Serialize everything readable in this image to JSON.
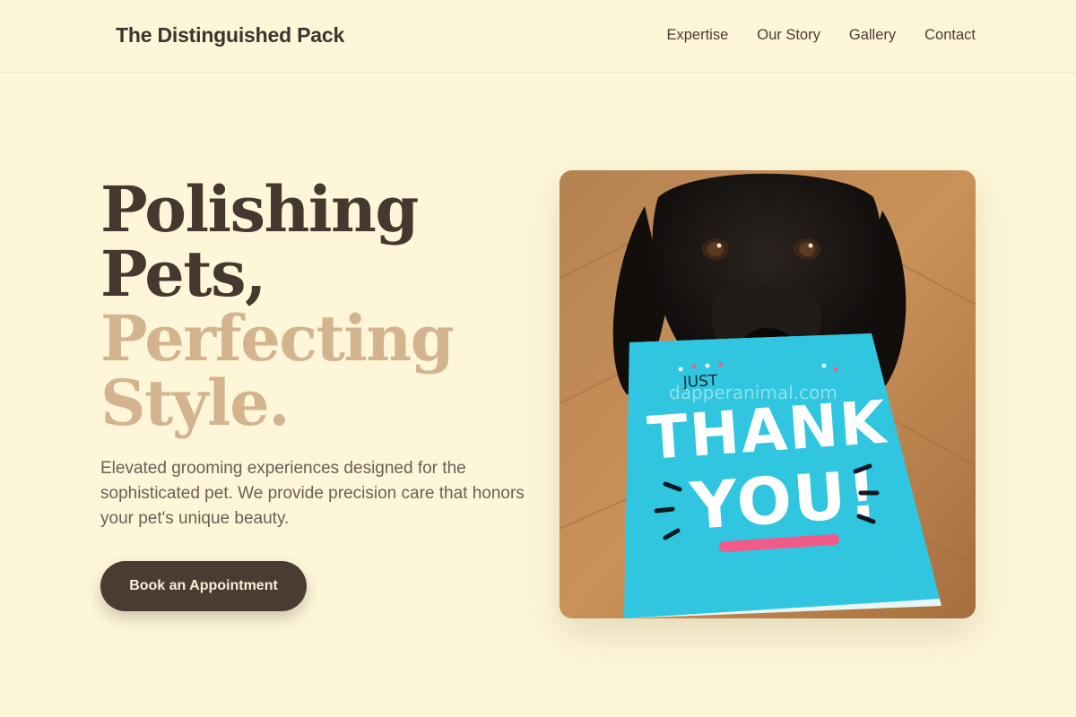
{
  "header": {
    "brand": "The Distinguished Pack",
    "nav": [
      "Expertise",
      "Our Story",
      "Gallery",
      "Contact"
    ]
  },
  "hero": {
    "title_line1": "Polishing",
    "title_line2": "Pets,",
    "title_line3": "Perfecting",
    "title_line4": "Style.",
    "tagline": "Elevated grooming experiences designed for the sophisticated pet. We provide precision care that honors your pet's unique beauty.",
    "cta_label": "Book an Appointment"
  },
  "photo": {
    "card_small_text": "JUST",
    "card_word1": "THANK",
    "card_word2": "YOU!",
    "watermark": "dapperanimal.com"
  },
  "colors": {
    "background": "#fdf6d8",
    "text_dark": "#45392f",
    "accent_tan": "#d4b48e",
    "button": "#4a3c33",
    "card_cyan": "#2ec6de",
    "card_pink": "#f25a8a"
  },
  "icons": [
    "dog-photo"
  ]
}
